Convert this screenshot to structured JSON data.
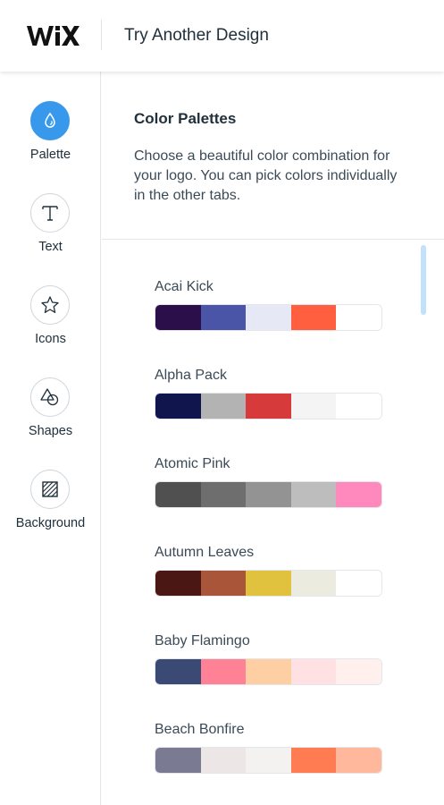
{
  "header": {
    "logo_text": "WiX",
    "try_another_label": "Try Another Design"
  },
  "sidebar": {
    "items": [
      {
        "label": "Palette",
        "icon": "palette-drop-icon",
        "active": true
      },
      {
        "label": "Text",
        "icon": "text-t-icon",
        "active": false
      },
      {
        "label": "Icons",
        "icon": "star-icon",
        "active": false
      },
      {
        "label": "Shapes",
        "icon": "shapes-icon",
        "active": false
      },
      {
        "label": "Background",
        "icon": "background-hatch-icon",
        "active": false
      }
    ]
  },
  "panel": {
    "title": "Color Palettes",
    "description": "Choose a beautiful color combination for your logo. You can pick colors individually in the other tabs."
  },
  "palettes": [
    {
      "name": "Acai Kick",
      "colors": [
        "#2a0f4a",
        "#4b55a8",
        "#e6e8f5",
        "#ff5f3f",
        "#ffffff"
      ]
    },
    {
      "name": "Alpha Pack",
      "colors": [
        "#10154e",
        "#b3b3b3",
        "#d63a3a",
        "#f4f4f4",
        "#ffffff"
      ]
    },
    {
      "name": "Atomic Pink",
      "colors": [
        "#505050",
        "#6e6e6e",
        "#939393",
        "#bdbdbd",
        "#ff89bd"
      ]
    },
    {
      "name": "Autumn Leaves",
      "colors": [
        "#4a1714",
        "#a8553a",
        "#e0c23f",
        "#ecebe0",
        "#ffffff"
      ]
    },
    {
      "name": "Baby Flamingo",
      "colors": [
        "#3a4a74",
        "#ff8196",
        "#ffcfa4",
        "#ffe1e3",
        "#fff0ee"
      ]
    },
    {
      "name": "Beach Bonfire",
      "colors": [
        "#7a7a92",
        "#ece6e6",
        "#f3f2f0",
        "#ff7c52",
        "#ffb89c"
      ]
    }
  ],
  "colors": {
    "accent": "#3899ec",
    "text": "#20303c",
    "divider": "#e3e6ea",
    "scrollbar": "#c2e1fb"
  }
}
